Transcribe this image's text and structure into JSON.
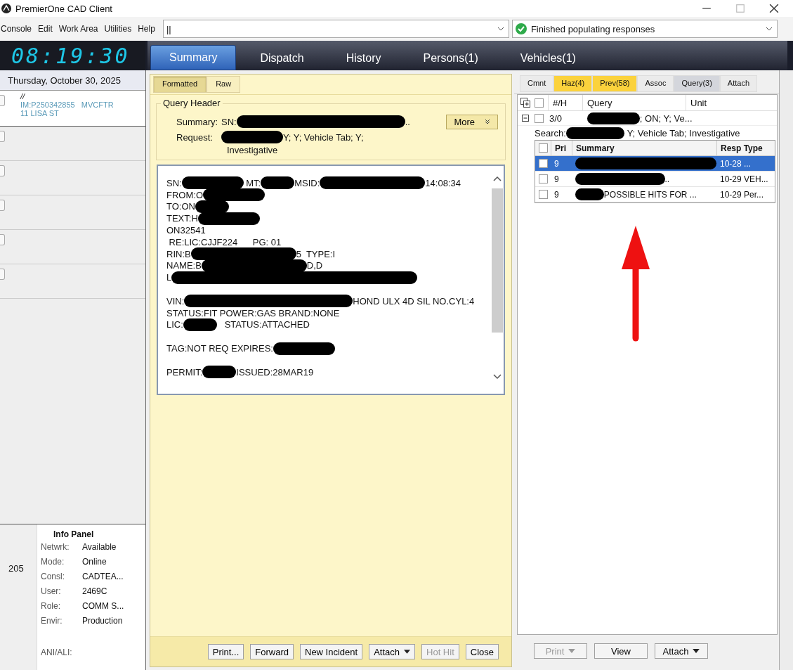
{
  "window": {
    "title": "PremierOne CAD Client"
  },
  "menu": [
    "Console",
    "Edit",
    "Work Area",
    "Utilities",
    "Help"
  ],
  "command_field": {
    "value": "||"
  },
  "status_field": {
    "value": "Finished populating responses"
  },
  "clock": "08:19:30",
  "tabs": [
    {
      "label": "Summary",
      "selected": true
    },
    {
      "label": "Dispatch",
      "selected": false
    },
    {
      "label": "History",
      "selected": false
    },
    {
      "label": "Persons(1)",
      "selected": false
    },
    {
      "label": "Vehicles(1)",
      "selected": false
    }
  ],
  "date": "Thursday, October 30, 2025",
  "incidents": [
    {
      "line_1": "//",
      "line_2": "IM:P250342855   MVCFTR",
      "line_3": "11 LISA ST",
      "selected": true
    }
  ],
  "unit_count": "205",
  "info_panel": {
    "title": "Info Panel",
    "rows": [
      {
        "label": "Netwrk:",
        "value": "Available"
      },
      {
        "label": "Mode:",
        "value": "Online"
      },
      {
        "label": "Consl:",
        "value": "CADTEA..."
      },
      {
        "label": "User:",
        "value": "2469C"
      },
      {
        "label": "Role:",
        "value": "COMM S..."
      },
      {
        "label": "Envir:",
        "value": "Production"
      }
    ],
    "ani_label": "ANI/ALI:"
  },
  "view_tabs": [
    {
      "label": "Formatted",
      "selected": true
    },
    {
      "label": "Raw",
      "selected": false
    }
  ],
  "query_header": {
    "title": "Query Header",
    "summary_label": "Summary:",
    "summary": [
      {
        "kind": "text",
        "text": "SN:"
      },
      {
        "kind": "redact-xl"
      },
      {
        "kind": "text",
        "text": ".."
      }
    ],
    "more_button": "More",
    "request_label": "Request:",
    "request": [
      {
        "kind": "redact-m"
      },
      {
        "kind": "text",
        "text": "Y; Y; Vehicle Tab; Y;"
      }
    ],
    "request_line_2": "Investigative"
  },
  "response_lines": [
    {
      "kind": "line",
      "segments": [
        {
          "kind": "text",
          "text": "SN:"
        },
        {
          "kind": "redact-m"
        },
        {
          "kind": "text",
          "text": " MT:"
        },
        {
          "kind": "redact-s"
        },
        {
          "kind": "text",
          "text": "MSID:"
        },
        {
          "kind": "redact-l"
        },
        {
          "kind": "text",
          "text": "14:08:34"
        }
      ]
    },
    {
      "kind": "line",
      "segments": [
        {
          "kind": "text",
          "text": "FROM:O"
        },
        {
          "kind": "redact-m"
        }
      ]
    },
    {
      "kind": "line",
      "segments": [
        {
          "kind": "text",
          "text": "TO:ON"
        },
        {
          "kind": "redact-s"
        }
      ]
    },
    {
      "kind": "line",
      "segments": [
        {
          "kind": "text",
          "text": "TEXT:H"
        },
        {
          "kind": "redact-m"
        }
      ]
    },
    {
      "kind": "line",
      "segments": [
        {
          "kind": "text",
          "text": "ON32541"
        }
      ]
    },
    {
      "kind": "line",
      "segments": [
        {
          "kind": "text",
          "text": " RE:LIC:CJJF224      PG: 01"
        }
      ]
    },
    {
      "kind": "line",
      "segments": [
        {
          "kind": "text",
          "text": "RIN:B"
        },
        {
          "kind": "redact-l"
        },
        {
          "kind": "text",
          "text": "5  TYPE:I"
        }
      ]
    },
    {
      "kind": "line",
      "segments": [
        {
          "kind": "text",
          "text": "NAME:B"
        },
        {
          "kind": "redact-l"
        },
        {
          "kind": "text",
          "text": "D,D"
        }
      ]
    },
    {
      "kind": "line",
      "segments": [
        {
          "kind": "text",
          "text": "L"
        },
        {
          "kind": "redact-xxl"
        }
      ]
    },
    {
      "kind": "gap"
    },
    {
      "kind": "line",
      "segments": [
        {
          "kind": "text",
          "text": "VIN:"
        },
        {
          "kind": "redact-xl"
        },
        {
          "kind": "text",
          "text": "HOND ULX 4D SIL NO.CYL:4"
        }
      ]
    },
    {
      "kind": "line",
      "segments": [
        {
          "kind": "text",
          "text": "STATUS:FIT POWER:GAS BRAND:NONE"
        }
      ]
    },
    {
      "kind": "line",
      "segments": [
        {
          "kind": "text",
          "text": "LIC:"
        },
        {
          "kind": "redact-s"
        },
        {
          "kind": "text",
          "text": "   STATUS:ATTACHED"
        }
      ]
    },
    {
      "kind": "gap"
    },
    {
      "kind": "line",
      "segments": [
        {
          "kind": "text",
          "text": "TAG:NOT REQ EXPIRES:"
        },
        {
          "kind": "redact-m"
        }
      ]
    },
    {
      "kind": "gap"
    },
    {
      "kind": "line",
      "segments": [
        {
          "kind": "text",
          "text": "PERMIT:"
        },
        {
          "kind": "redact-s"
        },
        {
          "kind": "text",
          "text": "ISSUED:28MAR19"
        }
      ]
    }
  ],
  "bottom_buttons": [
    {
      "label": "Print...",
      "disabled": false,
      "dropdown": false
    },
    {
      "label": "Forward",
      "disabled": false,
      "dropdown": false
    },
    {
      "label": "New Incident",
      "disabled": false,
      "dropdown": false
    },
    {
      "label": "Attach",
      "disabled": false,
      "dropdown": true
    },
    {
      "label": "Hot Hit",
      "disabled": true,
      "dropdown": false
    },
    {
      "label": "Close",
      "disabled": false,
      "dropdown": false
    }
  ],
  "right_tabs": [
    {
      "label": "Cmnt",
      "highlighted": false,
      "selected": false
    },
    {
      "label": "Haz(4)",
      "highlighted": true,
      "selected": false
    },
    {
      "label": "Prev(58)",
      "highlighted": true,
      "selected": false
    },
    {
      "label": "Assoc",
      "highlighted": false,
      "selected": false
    },
    {
      "label": "Query(3)",
      "highlighted": false,
      "selected": true
    },
    {
      "label": "Attach",
      "highlighted": false,
      "selected": false
    }
  ],
  "query_table": {
    "columns": [
      "#/H",
      "Query",
      "Unit"
    ],
    "header_checked": false,
    "queries": [
      {
        "count": "3/0",
        "checked": false,
        "expanded": true,
        "query": [
          {
            "kind": "redact-m"
          },
          {
            "kind": "text",
            "text": "; ON; Y; Ve..."
          }
        ],
        "search": [
          {
            "kind": "text",
            "text": "Search:"
          },
          {
            "kind": "redact-m"
          },
          {
            "kind": "text",
            "text": " Y; Vehicle Tab; Investigative"
          }
        ],
        "response_columns": [
          "Pri",
          "Summary",
          "Resp Type"
        ],
        "responses_header_checked": false,
        "responses": [
          {
            "pri": "9",
            "checked": false,
            "selected": true,
            "summary": [
              {
                "kind": "redact-xl"
              }
            ],
            "resp_type": "10-28 ..."
          },
          {
            "pri": "9",
            "checked": false,
            "selected": false,
            "summary": [
              {
                "kind": "redact-l"
              },
              {
                "kind": "text",
                "text": ".."
              }
            ],
            "resp_type": "10-29 VEH..."
          },
          {
            "pri": "9",
            "checked": false,
            "selected": false,
            "summary": [
              {
                "kind": "redact-s"
              },
              {
                "kind": "text",
                "text": "POSSIBLE HITS FOR ..."
              }
            ],
            "resp_type": "10-29 Per..."
          }
        ]
      }
    ]
  },
  "right_buttons": [
    {
      "label": "Print",
      "disabled": true,
      "dropdown": true
    },
    {
      "label": "View",
      "disabled": false,
      "dropdown": false
    },
    {
      "label": "Attach",
      "disabled": false,
      "dropdown": true
    }
  ]
}
